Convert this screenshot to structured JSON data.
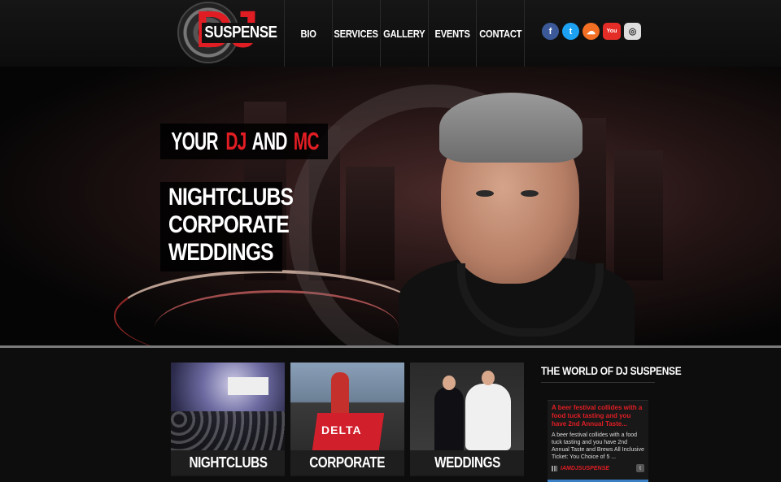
{
  "header": {
    "logo": {
      "dj": "DJ",
      "word": "SUSPENSE"
    },
    "nav": [
      {
        "label": "BIO",
        "width": 58
      },
      {
        "label": "SERVICES",
        "width": 58
      },
      {
        "label": "GALLERY",
        "width": 59
      },
      {
        "label": "EVENTS",
        "width": 57
      },
      {
        "label": "CONTACT",
        "width": 58
      }
    ],
    "social": [
      {
        "name": "facebook-icon",
        "glyph": "f"
      },
      {
        "name": "twitter-icon",
        "glyph": "t"
      },
      {
        "name": "soundcloud-icon",
        "glyph": "☁"
      },
      {
        "name": "youtube-icon",
        "glyph": "You"
      },
      {
        "name": "instagram-icon",
        "glyph": "◎"
      }
    ]
  },
  "hero": {
    "tagline": {
      "part1": "YOUR ",
      "part2": "DJ",
      "part3": " AND ",
      "part4": "MC"
    },
    "services": [
      "NIGHTCLUBS",
      "CORPORATE",
      "WEDDINGS"
    ]
  },
  "cards": [
    {
      "label": "NIGHTCLUBS"
    },
    {
      "label": "CORPORATE",
      "photo_text": "DELTA"
    },
    {
      "label": "WEDDINGS"
    }
  ],
  "world": {
    "title": "THE WORLD OF DJ SUSPENSE",
    "tweet_title": "A beer festival collides with a food tuck tasting and you have 2nd Annual Taste...",
    "tweet_body": "A beer festival collides with a food tuck tasting and you have 2nd Annual Taste and Brews All Inclusive Ticket: You Choice of 5 ...",
    "handle": "IAMDJSUSPENSE"
  }
}
